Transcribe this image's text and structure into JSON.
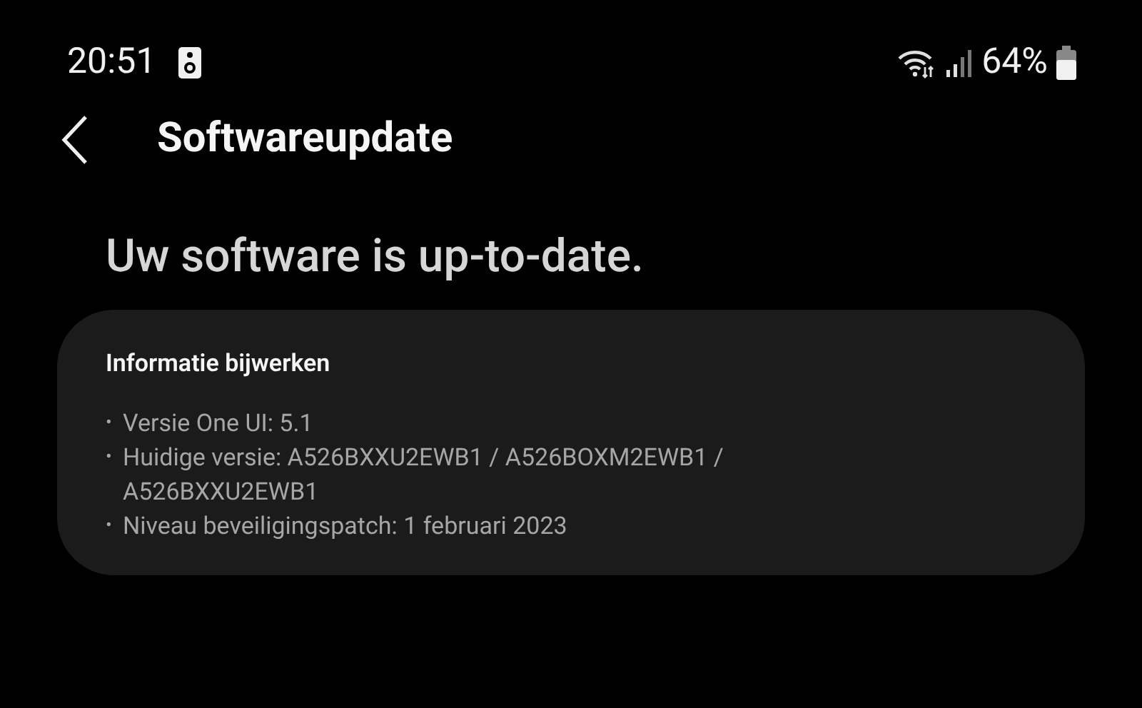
{
  "status_bar": {
    "time": "20:51",
    "battery_percent": "64%"
  },
  "header": {
    "title": "Softwareupdate"
  },
  "status_heading": "Uw software is up-to-date.",
  "info_card": {
    "title": "Informatie bijwerken",
    "items": [
      {
        "bullet": "•",
        "text": "Versie One UI: 5.1"
      },
      {
        "bullet": "•",
        "text": "Huidige versie: A526BXXU2EWB1 / A526BOXM2EWB1 / A526BXXU2EWB1"
      },
      {
        "bullet": "•",
        "text": "Niveau beveiligingspatch: 1 februari 2023"
      }
    ]
  }
}
